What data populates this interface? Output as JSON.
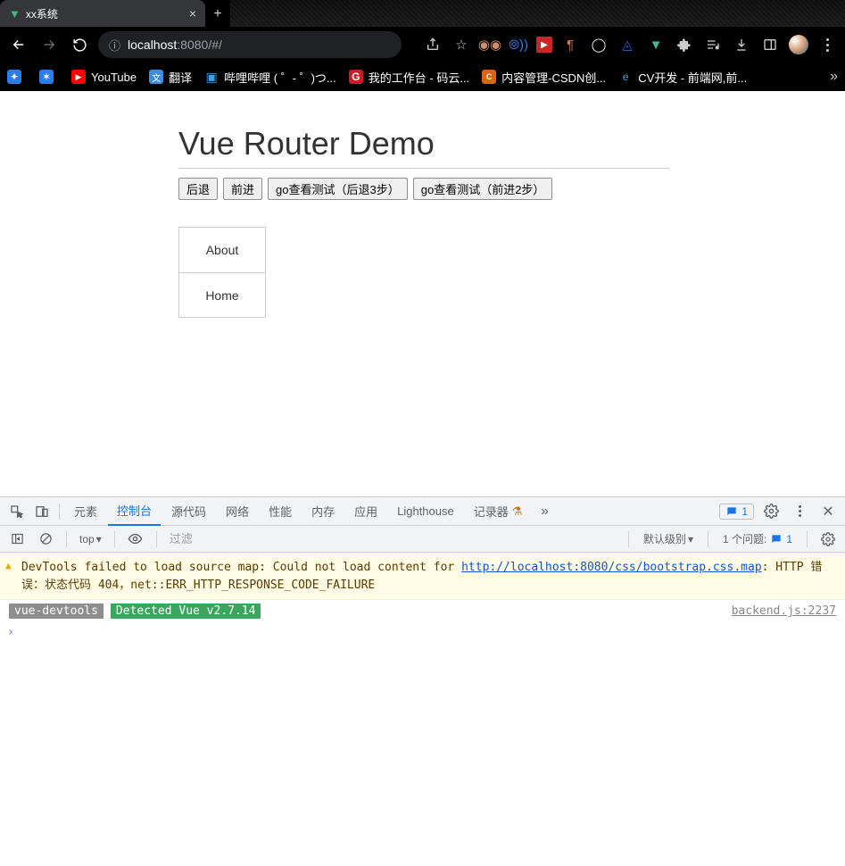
{
  "browser": {
    "tab_title": "xx系统",
    "url_host": "localhost",
    "url_port": ":8080",
    "url_path": "/#/"
  },
  "bookmarks": [
    {
      "label": "",
      "icon": "blue-a"
    },
    {
      "label": "",
      "icon": "blue-ai"
    },
    {
      "label": "YouTube",
      "icon": "youtube"
    },
    {
      "label": "翻译",
      "icon": "lblue"
    },
    {
      "label": "哔哩哔哩 ( ゜- ゜)つ...",
      "icon": "bili"
    },
    {
      "label": "我的工作台 - 码云...",
      "icon": "gitee"
    },
    {
      "label": "内容管理-CSDN创...",
      "icon": "csdn"
    },
    {
      "label": "CV开发 - 前端网,前...",
      "icon": "edge"
    }
  ],
  "page": {
    "heading": "Vue Router Demo",
    "buttons": {
      "back": "后退",
      "forward": "前进",
      "go_back3": "go查看测试（后退3步）",
      "go_fwd2": "go查看测试（前进2步）"
    },
    "links": {
      "about": "About",
      "home": "Home"
    }
  },
  "devtools": {
    "tabs": {
      "elements": "元素",
      "console": "控制台",
      "sources": "源代码",
      "network": "网络",
      "performance": "性能",
      "memory": "内存",
      "application": "应用",
      "lighthouse": "Lighthouse",
      "recorder": "记录器"
    },
    "msg_badge": "1",
    "filter": {
      "scope": "top",
      "placeholder": "过滤",
      "level": "默认级别",
      "issues_label": "1 个问题:",
      "issues_count": "1"
    },
    "warn": {
      "prefix": "DevTools failed to load source map: Could not load content for ",
      "link": "http://localhost:8080/css/bootstrap.css.map",
      "suffix": ": HTTP 错误：状态代码 404，net::ERR_HTTP_RESPONSE_CODE_FAILURE"
    },
    "log": {
      "tag": "vue-devtools",
      "msg": "Detected Vue v2.7.14",
      "src": "backend.js:2237"
    },
    "prompt": "›"
  }
}
